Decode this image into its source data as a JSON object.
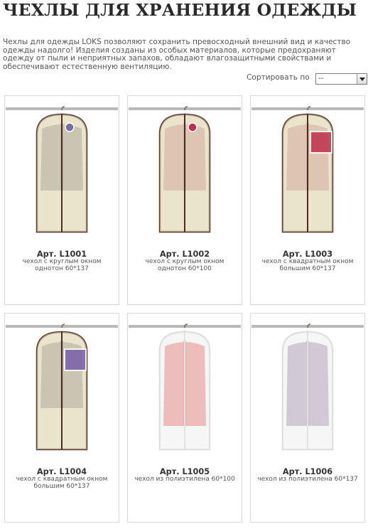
{
  "page": {
    "title": "ЧЕХЛЫ ДЛЯ ХРАНЕНИЯ ОДЕЖДЫ",
    "intro": "Чехлы для одежды LOKS позволяют сохранить превосходный внешний вид и качество одежды надолго! Изделия созданы из особых материалов, которые предохраняют одежду от пыли и неприятных запахов, обладают влагозащитными свойствами и обеспечивают естественную вентиляцию."
  },
  "sort": {
    "label": "Сортировать по",
    "selected": "--"
  },
  "products": [
    {
      "art": "Арт. L1001",
      "desc": "чехол с круглым окном однотон 60*137",
      "cover": "beige",
      "garment": "gray",
      "window": "round",
      "window_color": "#7a6aa6"
    },
    {
      "art": "Арт. L1002",
      "desc": "чехол с круглым окном однотон 60*100",
      "cover": "beige",
      "garment": "salmon",
      "window": "round",
      "window_color": "#c0304a"
    },
    {
      "art": "Арт. L1003",
      "desc": "чехол с квадратным окном большим 60*137",
      "cover": "beige",
      "garment": "salmon",
      "window": "square",
      "window_color": "#c0304a"
    },
    {
      "art": "Арт. L1004",
      "desc": "чехол с квадратным окном большим 60*137",
      "cover": "beige",
      "garment": "gray",
      "window": "square",
      "window_color": "#7a5fa8"
    },
    {
      "art": "Арт. L1005",
      "desc": "чехол из полиэтилена 60*100",
      "cover": "clear",
      "garment": "red",
      "window": "none",
      "window_color": ""
    },
    {
      "art": "Арт. L1006",
      "desc": "чехол из полиэтилена 60*137",
      "cover": "clear",
      "garment": "lilac",
      "window": "none",
      "window_color": ""
    }
  ]
}
